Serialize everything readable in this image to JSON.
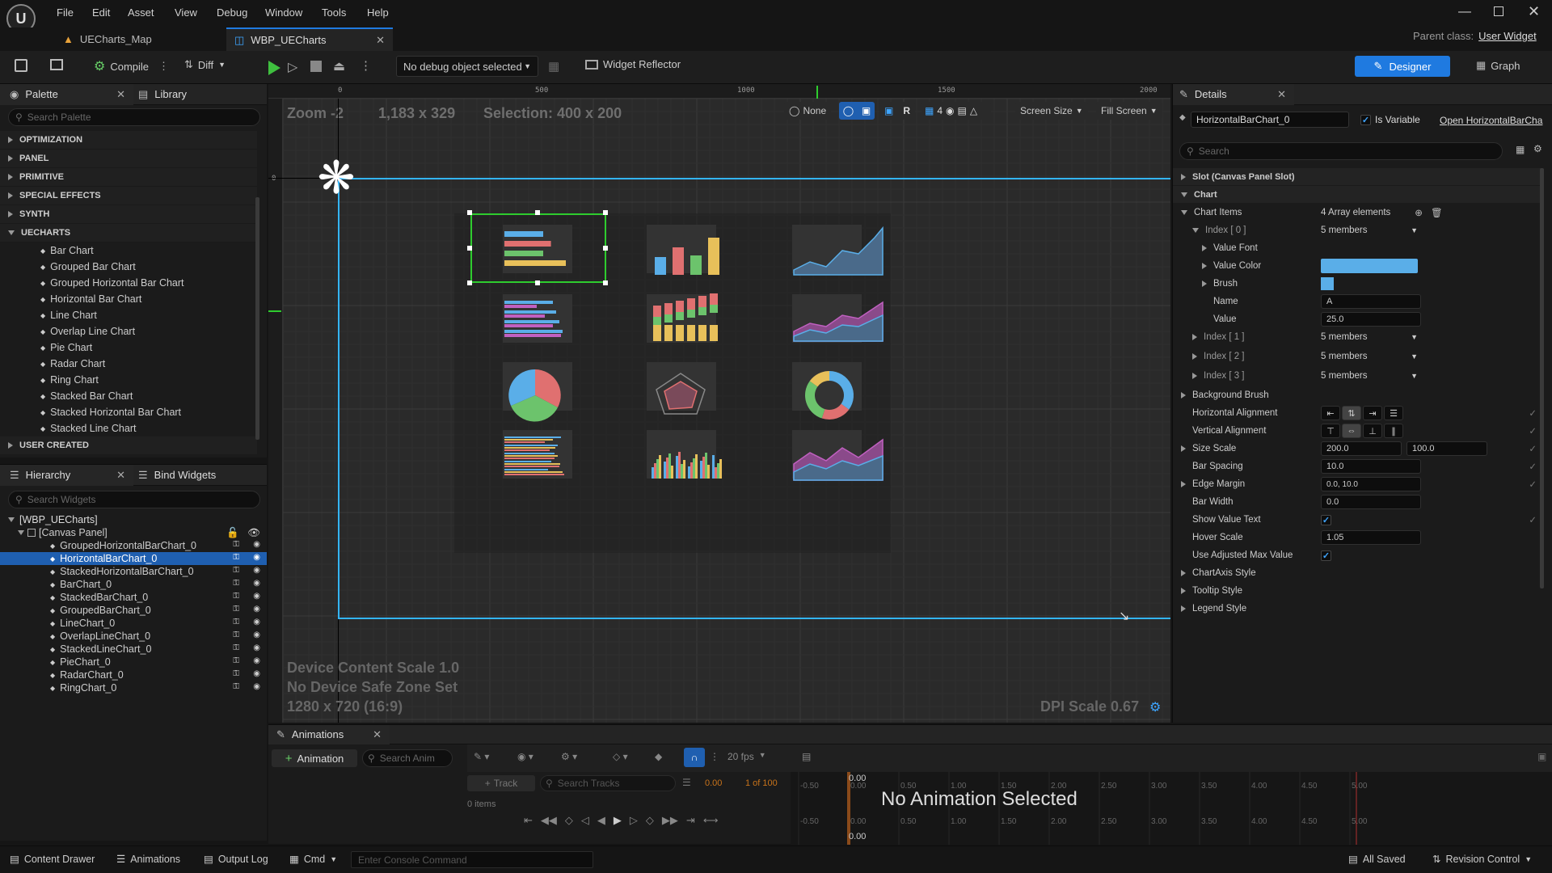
{
  "menu": {
    "items": [
      "File",
      "Edit",
      "Asset",
      "View",
      "Debug",
      "Window",
      "Tools",
      "Help"
    ]
  },
  "tabs": {
    "map": "UECharts_Map",
    "widget": "WBP_UECharts",
    "parent_class_label": "Parent class:",
    "parent_class_value": "User Widget"
  },
  "toolbar": {
    "compile": "Compile",
    "diff": "Diff",
    "debug_object": "No debug object selected",
    "widget_reflector": "Widget Reflector",
    "designer": "Designer",
    "graph": "Graph"
  },
  "palette": {
    "title": "Palette",
    "library": "Library",
    "search_placeholder": "Search Palette",
    "categories": [
      "OPTIMIZATION",
      "PANEL",
      "PRIMITIVE",
      "SPECIAL EFFECTS",
      "SYNTH",
      "UECHARTS"
    ],
    "uecharts_items": [
      "Bar Chart",
      "Grouped Bar Chart",
      "Grouped Horizontal Bar Chart",
      "Horizontal Bar Chart",
      "Line Chart",
      "Overlap Line Chart",
      "Pie Chart",
      "Radar Chart",
      "Ring Chart",
      "Stacked Bar Chart",
      "Stacked Horizontal Bar Chart",
      "Stacked Line Chart"
    ],
    "user_created": "USER CREATED"
  },
  "hierarchy": {
    "title": "Hierarchy",
    "bind_widgets": "Bind Widgets",
    "search_placeholder": "Search Widgets",
    "root": "[WBP_UECharts]",
    "canvas": "[Canvas Panel]",
    "items": [
      "GroupedHorizontalBarChart_0",
      "HorizontalBarChart_0",
      "StackedHorizontalBarChart_0",
      "BarChart_0",
      "StackedBarChart_0",
      "GroupedBarChart_0",
      "LineChart_0",
      "OverlapLineChart_0",
      "StackedLineChart_0",
      "PieChart_0",
      "RadarChart_0",
      "RingChart_0"
    ],
    "selected_index": 1
  },
  "viewport": {
    "zoom": "Zoom -2",
    "size": "1,183 x 329",
    "selection": "Selection: 400 x 200",
    "ruler_top": [
      "0",
      "500",
      "1000",
      "1500",
      "2000"
    ],
    "ruler_left": [
      "0",
      "5",
      "0",
      "0",
      "1",
      "0",
      "0"
    ],
    "none": "None",
    "r": "R",
    "grid": "4",
    "screen_size": "Screen Size",
    "fill_screen": "Fill Screen",
    "device_scale": "Device Content Scale 1.0",
    "safe_zone": "No Device Safe Zone Set",
    "resolution": "1280 x 720 (16:9)",
    "dpi": "DPI Scale 0.67"
  },
  "details": {
    "title": "Details",
    "widget_name": "HorizontalBarChart_0",
    "is_variable": "Is Variable",
    "open_link": "Open HorizontalBarCha",
    "search_placeholder": "Search",
    "slot_section": "Slot (Canvas Panel Slot)",
    "chart_section": "Chart",
    "chart_items_label": "Chart Items",
    "chart_items_value": "4 Array elements",
    "index0": "Index [ 0 ]",
    "members": "5 members",
    "value_font": "Value Font",
    "value_color": "Value Color",
    "brush": "Brush",
    "name_label": "Name",
    "name_value": "A",
    "value_label": "Value",
    "value_value": "25.0",
    "index1": "Index [ 1 ]",
    "index2": "Index [ 2 ]",
    "index3": "Index [ 3 ]",
    "background_brush": "Background Brush",
    "horizontal_alignment": "Horizontal Alignment",
    "vertical_alignment": "Vertical Alignment",
    "size_scale": "Size Scale",
    "size_scale_x": "200.0",
    "size_scale_y": "100.0",
    "bar_spacing": "Bar Spacing",
    "bar_spacing_value": "10.0",
    "edge_margin": "Edge Margin",
    "edge_margin_value": "0.0, 10.0",
    "bar_width": "Bar Width",
    "bar_width_value": "0.0",
    "show_value_text": "Show Value Text",
    "hover_scale": "Hover Scale",
    "hover_scale_value": "1.05",
    "use_adjusted": "Use Adjusted Max Value",
    "chartaxis_style": "ChartAxis Style",
    "tooltip_style": "Tooltip Style",
    "legend_style": "Legend Style",
    "value_color_hex": "#5aaee8"
  },
  "animations": {
    "title": "Animations",
    "add": "Animation",
    "search_placeholder": "Search Anim",
    "fps": "20 fps",
    "track": "Track",
    "search_tracks": "Search Tracks",
    "time": "0.00",
    "frame": "1 of 100",
    "items": "0 items",
    "no_animation": "No Animation Selected",
    "ticks": [
      "-0.50",
      "0.00",
      "0.50",
      "1.00",
      "1.50",
      "2.00",
      "2.50",
      "3.00",
      "3.50",
      "4.00",
      "4.50",
      "5.00"
    ],
    "time_top": "0.00",
    "time_bottom": "0.00"
  },
  "statusbar": {
    "content_drawer": "Content Drawer",
    "animations": "Animations",
    "output_log": "Output Log",
    "cmd": "Cmd",
    "console_placeholder": "Enter Console Command",
    "all_saved": "All Saved",
    "revision_control": "Revision Control"
  },
  "colors": {
    "accent": "#1f7ae0",
    "selection_green": "#2ecc2e",
    "safezone_cyan": "#33b5ff",
    "bg_dark": "#151515"
  }
}
